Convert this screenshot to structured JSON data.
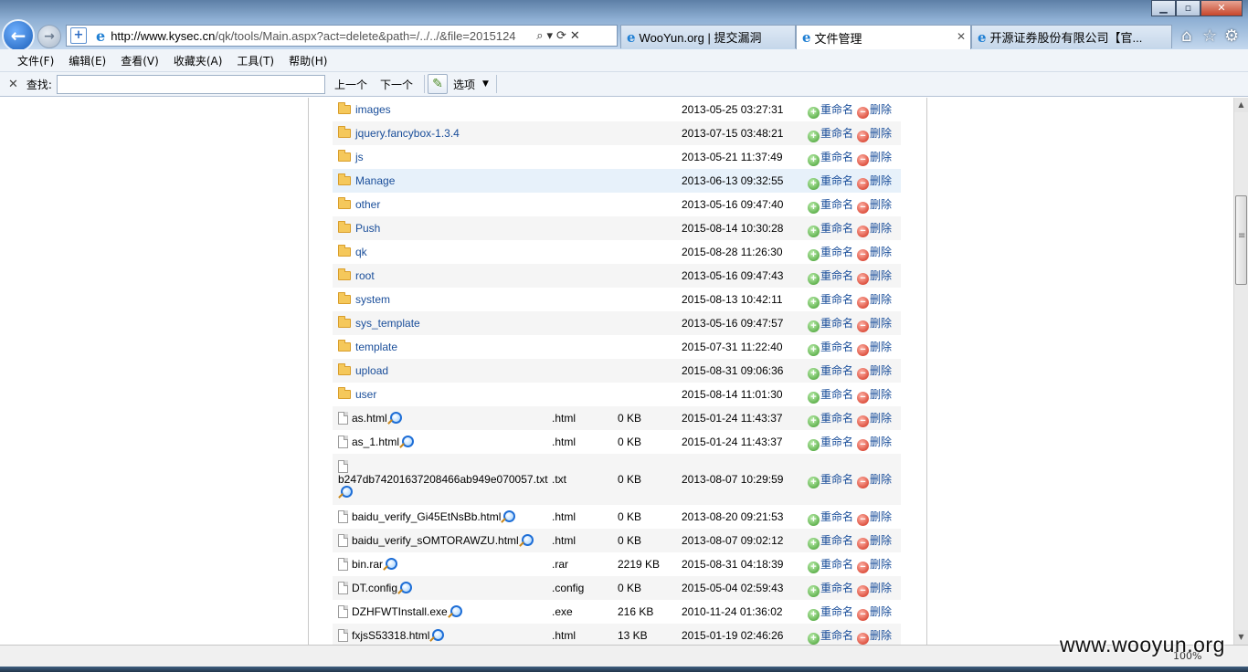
{
  "browser": {
    "address": {
      "url_host": "http://www.kysec.cn",
      "url_rest": "/qk/tools/Main.aspx?act=delete&path=/../../&file=2015124"
    },
    "tabs": [
      {
        "label": "WooYun.org | 提交漏洞",
        "active": false
      },
      {
        "label": "文件管理",
        "active": true
      },
      {
        "label": "开源证券股份有限公司【官...",
        "active": false
      }
    ],
    "close_tab_glyph": "✕",
    "window_controls": {
      "minimize": "▁",
      "maximize": "▫",
      "close": "✕"
    }
  },
  "menubar": {
    "items": [
      "文件(F)",
      "编辑(E)",
      "查看(V)",
      "收藏夹(A)",
      "工具(T)",
      "帮助(H)"
    ]
  },
  "findbar": {
    "close": "✕",
    "label": "查找:",
    "input_value": "",
    "prev": "上一个",
    "next": "下一个",
    "options": "选项"
  },
  "file_list": {
    "actions": {
      "rename": "重命名",
      "delete": "删除"
    },
    "folders": [
      {
        "name": "images",
        "date": "2013-05-25 03:27:31"
      },
      {
        "name": "jquery.fancybox-1.3.4",
        "date": "2013-07-15 03:48:21"
      },
      {
        "name": "js",
        "date": "2013-05-21 11:37:49"
      },
      {
        "name": "Manage",
        "date": "2013-06-13 09:32:55"
      },
      {
        "name": "other",
        "date": "2013-05-16 09:47:40"
      },
      {
        "name": "Push",
        "date": "2015-08-14 10:30:28"
      },
      {
        "name": "qk",
        "date": "2015-08-28 11:26:30"
      },
      {
        "name": "root",
        "date": "2013-05-16 09:47:43"
      },
      {
        "name": "system",
        "date": "2015-08-13 10:42:11"
      },
      {
        "name": "sys_template",
        "date": "2013-05-16 09:47:57"
      },
      {
        "name": "template",
        "date": "2015-07-31 11:22:40"
      },
      {
        "name": "upload",
        "date": "2015-08-31 09:06:36"
      },
      {
        "name": "user",
        "date": "2015-08-14 11:01:30"
      }
    ],
    "files": [
      {
        "name": "as.html",
        "ext": ".html",
        "size": "0 KB",
        "date": "2015-01-24 11:43:37"
      },
      {
        "name": "as_1.html",
        "ext": ".html",
        "size": "0 KB",
        "date": "2015-01-24 11:43:37"
      },
      {
        "name": "b247db74201637208466ab949e070057.txt",
        "ext": ".txt",
        "size": "0 KB",
        "date": "2013-08-07 10:29:59"
      },
      {
        "name": "baidu_verify_Gi45EtNsBb.html",
        "ext": ".html",
        "size": "0 KB",
        "date": "2013-08-20 09:21:53"
      },
      {
        "name": "baidu_verify_sOMTORAWZU.html",
        "ext": ".html",
        "size": "0 KB",
        "date": "2013-08-07 09:02:12"
      },
      {
        "name": "bin.rar",
        "ext": ".rar",
        "size": "2219 KB",
        "date": "2015-08-31 04:18:39"
      },
      {
        "name": "DT.config",
        "ext": ".config",
        "size": "0 KB",
        "date": "2015-05-04 02:59:43"
      },
      {
        "name": "DZHFWTInstall.exe",
        "ext": ".exe",
        "size": "216 KB",
        "date": "2010-11-24 01:36:02"
      },
      {
        "name": "fxjsS53318.html",
        "ext": ".html",
        "size": "13 KB",
        "date": "2015-01-19 02:46:26"
      }
    ]
  },
  "statusbar": {
    "zoom": "100%",
    "watermark": "www.wooyun.org"
  }
}
